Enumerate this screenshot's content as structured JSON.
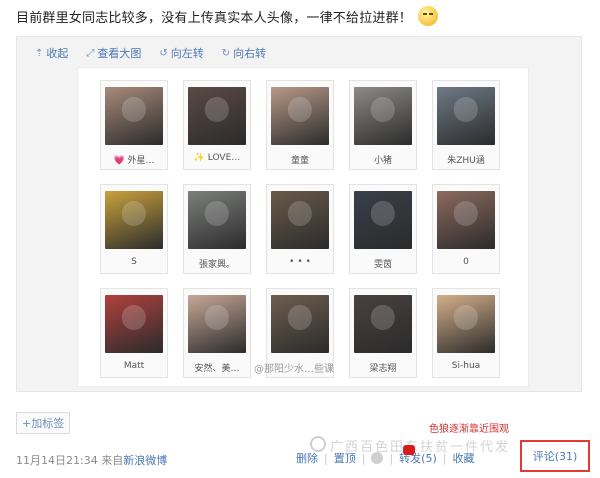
{
  "post": {
    "text": "目前群里女同志比较多，没有上传真实本人头像，一律不给拉进群！",
    "emoji_icon": "smirk-emoji-icon"
  },
  "toolbar": {
    "collapse": "收起",
    "view_large": "查看大图",
    "rotate_left": "向左转",
    "rotate_right": "向右转"
  },
  "members": [
    {
      "name": "💗 外星…",
      "color": "#a78b7a"
    },
    {
      "name": "✨ LOVE…",
      "color": "#5a4a45"
    },
    {
      "name": "童童",
      "color": "#b89a88"
    },
    {
      "name": "小猪",
      "color": "#8d8a86"
    },
    {
      "name": "朱ZHU涵",
      "color": "#6e7a86"
    },
    {
      "name": "S",
      "color": "#c9a23c"
    },
    {
      "name": "張家興。",
      "color": "#7c7f7c"
    },
    {
      "name": "• • •",
      "color": "#6a5a4a"
    },
    {
      "name": "雯茵",
      "color": "#39404a"
    },
    {
      "name": "0",
      "color": "#8c6a5f"
    },
    {
      "name": "Matt",
      "color": "#b0413e"
    },
    {
      "name": "安然、美…",
      "color": "#c7a898"
    },
    {
      "name": "",
      "color": "#6e5e4e"
    },
    {
      "name": "梁志翔",
      "color": "#4a4040"
    },
    {
      "name": "Si-hua",
      "color": "#d4b08a"
    }
  ],
  "image_watermark": "@那阳少水…些课",
  "tag_button": "+加标签",
  "footer": {
    "time": "11月14日21:34",
    "source_prefix": "来自",
    "source": "新浪微博",
    "delete": "删除",
    "pin": "置顶",
    "forward": "转发(5)",
    "favorite": "收藏",
    "comment": "评论(31)"
  },
  "red_note": "色狼逐渐靠近围观",
  "overlay_watermark": "广西百色田东扶贫一件代发",
  "colors": {
    "link": "#4a7ab5",
    "highlight_border": "#e53935"
  }
}
